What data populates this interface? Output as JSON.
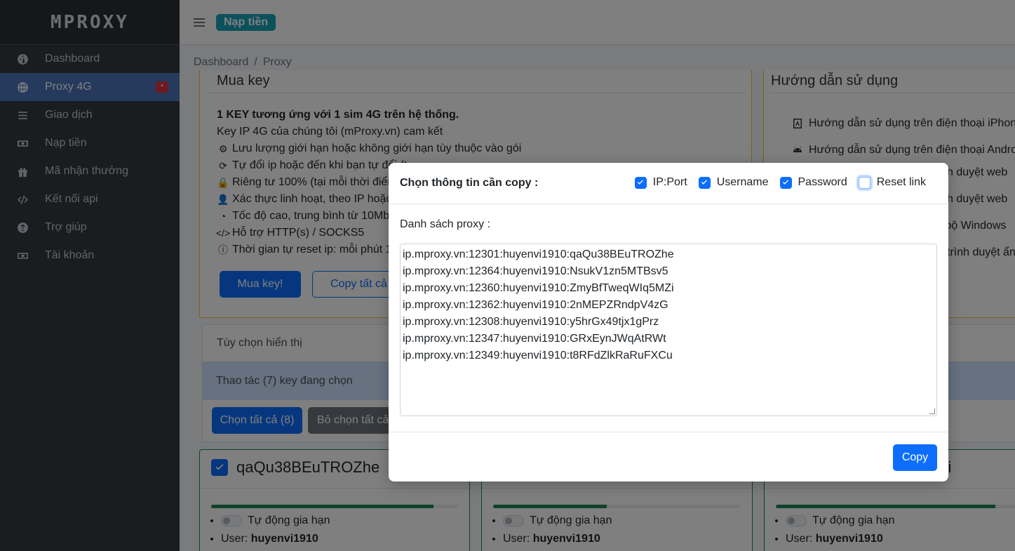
{
  "brand": "MPROXY",
  "sidebar": {
    "items": [
      {
        "label": "Dashboard",
        "icon": "dashboard-icon"
      },
      {
        "label": "Proxy 4G",
        "icon": "globe-icon",
        "active": true,
        "badge": "*"
      },
      {
        "label": "Giao dịch",
        "icon": "list-icon"
      },
      {
        "label": "Nạp tiền",
        "icon": "money-icon"
      },
      {
        "label": "Mã nhận thưởng",
        "icon": "gift-icon"
      },
      {
        "label": "Kết nối api",
        "icon": "code-icon"
      },
      {
        "label": "Trợ giúp",
        "icon": "question-icon"
      },
      {
        "label": "Tài khoản",
        "icon": "wallet-icon"
      }
    ]
  },
  "topbar": {
    "nap_label": "Nạp tiền"
  },
  "breadcrumb": {
    "home": "Dashboard",
    "sep": "/",
    "current": "Proxy"
  },
  "buy_card": {
    "title": "Mua key",
    "lines": [
      "1 KEY tương ứng với 1 sim 4G trên hệ thống.",
      "Key IP 4G của chúng tôi (mProxy.vn) cam kết",
      "Lưu lượng giới hạn hoặc không giới hạn tùy thuộc vào gói",
      "Tự đổi ip hoặc đến khi bạn tự đổi (t",
      "Riêng tư 100% (tại mỗi thời điểm",
      "Xác thực linh hoạt, theo IP hoặc",
      "Tốc độ cao, trung bình từ 10Mb",
      "Hỗ trợ HTTP(s) / SOCKS5",
      "Thời gian tự reset ip: mỗi phút 1"
    ],
    "buy_label": "Mua key!",
    "copy_all_label": "Copy tất cả"
  },
  "guide_card": {
    "title": "Hướng dẫn sử dụng",
    "lines": [
      "Hướng dẫn sử dụng trên điện thoại iPhone",
      "Hướng dẫn sử dụng trên điện thoại Android",
      "h duyệt web",
      "h duyệt web",
      "n bộ Windows",
      "trình duyệt ẩn"
    ]
  },
  "display_options": "Tùy chọn hiển thị",
  "selection_bar": "Thao tác (7) key đang chọn",
  "select_all_label": "Chọn tất cả (8)",
  "unselect_all_label": "Bỏ chọn tất cả",
  "proxy_cards": [
    {
      "name": "qaQu38BEuTROZhe",
      "progress": 0.9,
      "auto_renew": "Tự động gia hạn",
      "user_label": "User:",
      "user": "huyenvi1910"
    },
    {
      "name": "",
      "progress": 0.46,
      "auto_renew": "Tự động gia hạn",
      "user_label": "User:",
      "user": "huyenvi1910"
    },
    {
      "name": "Zi",
      "progress": 0.89,
      "auto_renew": "Tự động gia hạn",
      "user_label": "User:",
      "user": "huyenvi1910"
    }
  ],
  "modal": {
    "title": "Chọn thông tin cần copy :",
    "checks": [
      {
        "label": "IP:Port",
        "checked": true
      },
      {
        "label": "Username",
        "checked": true
      },
      {
        "label": "Password",
        "checked": true
      },
      {
        "label": "Reset link",
        "checked": false
      }
    ],
    "list_label": "Danh sách proxy :",
    "proxies": [
      "ip.mproxy.vn:12301:huyenvi1910:qaQu38BEuTROZhe",
      "ip.mproxy.vn:12364:huyenvi1910:NsukV1zn5MTBsv5",
      "ip.mproxy.vn:12360:huyenvi1910:ZmyBfTweqWIq5MZi",
      "ip.mproxy.vn:12362:huyenvi1910:2nMEPZRndpV4zG",
      "ip.mproxy.vn:12308:huyenvi1910:y5hrGx49tjx1gPrz",
      "ip.mproxy.vn:12347:huyenvi1910:GRxEynJWqAtRWt",
      "ip.mproxy.vn:12349:huyenvi1910:t8RFdZlkRaRuFXCu"
    ],
    "copy_label": "Copy"
  }
}
